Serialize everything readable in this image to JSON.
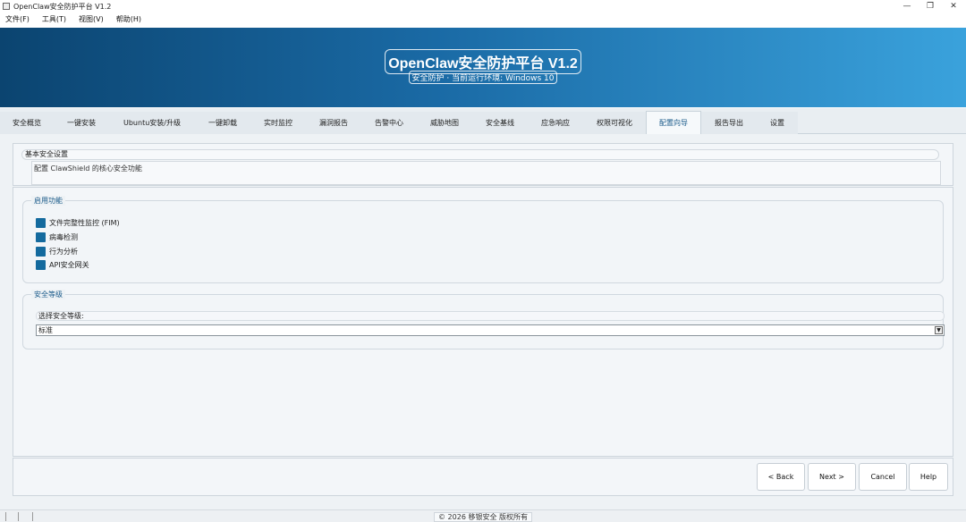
{
  "window": {
    "title": "OpenClaw安全防护平台 V1.2",
    "minimize": "—",
    "maximize": "❐",
    "close": "✕"
  },
  "menu": [
    "文件(F)",
    "工具(T)",
    "视图(V)",
    "帮助(H)"
  ],
  "banner": {
    "title": "OpenClaw安全防护平台 V1.2",
    "subtitle": "安全防护 · 当前运行环境: Windows 10"
  },
  "tabs": [
    {
      "label": "安全概览"
    },
    {
      "label": "一键安装"
    },
    {
      "label": "Ubuntu安装/升级"
    },
    {
      "label": "一键卸载"
    },
    {
      "label": "实时监控"
    },
    {
      "label": "漏洞报告"
    },
    {
      "label": "告警中心"
    },
    {
      "label": "威胁地图"
    },
    {
      "label": "安全基线"
    },
    {
      "label": "应急响应"
    },
    {
      "label": "权限可视化"
    },
    {
      "label": "配置向导",
      "active": true
    },
    {
      "label": "报告导出"
    },
    {
      "label": "设置"
    }
  ],
  "basic": {
    "header": "基本安全设置",
    "desc": "配置 ClawShield 的核心安全功能"
  },
  "features": {
    "legend": "启用功能",
    "items": [
      {
        "label": "文件完整性监控 (FIM)",
        "checked": true
      },
      {
        "label": "病毒检测",
        "checked": true
      },
      {
        "label": "行为分析",
        "checked": true
      },
      {
        "label": "API安全网关",
        "checked": true
      }
    ]
  },
  "level": {
    "legend": "安全等级",
    "label": "选择安全等级:",
    "selected": "标准",
    "arrow": "▼"
  },
  "buttons": {
    "back": "< Back",
    "next": "Next >",
    "cancel": "Cancel",
    "help": "Help"
  },
  "status": {
    "text": "© 2026 移银安全 版权所有"
  },
  "colors": {
    "accent": "#146a9e",
    "banner_start": "#0b4470",
    "banner_end": "#3aa2dc"
  }
}
